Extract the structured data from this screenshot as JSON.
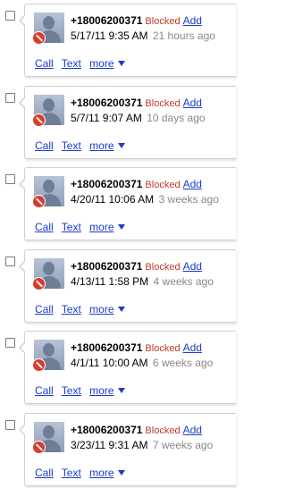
{
  "items": [
    {
      "number": "+18006200371",
      "status": "Blocked",
      "add": "Add",
      "datetime": "5/17/11 9:35 AM",
      "ago": "21 hours ago",
      "call": "Call",
      "text": "Text",
      "more": "more"
    },
    {
      "number": "+18006200371",
      "status": "Blocked",
      "add": "Add",
      "datetime": "5/7/11 9:07 AM",
      "ago": "10 days ago",
      "call": "Call",
      "text": "Text",
      "more": "more"
    },
    {
      "number": "+18006200371",
      "status": "Blocked",
      "add": "Add",
      "datetime": "4/20/11 10:06 AM",
      "ago": "3 weeks ago",
      "call": "Call",
      "text": "Text",
      "more": "more"
    },
    {
      "number": "+18006200371",
      "status": "Blocked",
      "add": "Add",
      "datetime": "4/13/11 1:58 PM",
      "ago": "4 weeks ago",
      "call": "Call",
      "text": "Text",
      "more": "more"
    },
    {
      "number": "+18006200371",
      "status": "Blocked",
      "add": "Add",
      "datetime": "4/1/11 10:00 AM",
      "ago": "6 weeks ago",
      "call": "Call",
      "text": "Text",
      "more": "more"
    },
    {
      "number": "+18006200371",
      "status": "Blocked",
      "add": "Add",
      "datetime": "3/23/11 9:31 AM",
      "ago": "7 weeks ago",
      "call": "Call",
      "text": "Text",
      "more": "more"
    }
  ],
  "colors": {
    "link": "#1a3cc8",
    "blocked": "#c0392b",
    "muted": "#888888"
  },
  "icons": {
    "avatar": "person-placeholder-icon",
    "blocked_badge": "blocked-icon",
    "more": "triangle-down-icon"
  }
}
